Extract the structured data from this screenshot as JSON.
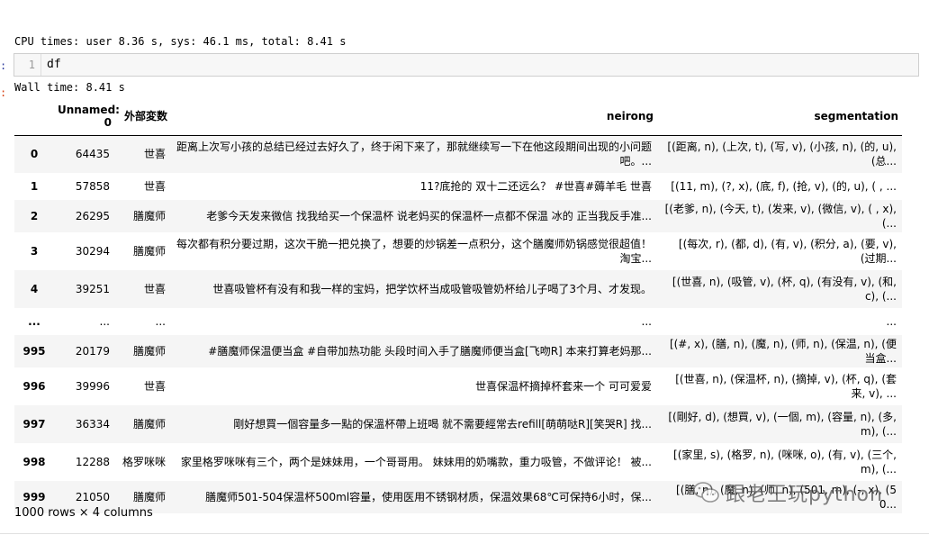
{
  "timing": {
    "cpu": "CPU times: user 8.36 s, sys: 46.1 ms, total: 8.41 s",
    "wall": "Wall time: 8.41 s"
  },
  "cell": {
    "prompt": ":",
    "line_number": "1",
    "code": "df",
    "out_prompt": ":"
  },
  "table": {
    "columns": [
      "Unnamed: 0",
      "外部変数",
      "neirong",
      "segmentation"
    ],
    "rows": [
      {
        "index": "0",
        "unnamed": "64435",
        "brand": "世喜",
        "neirong": "距离上次写小孩的总结已经过去好久了，终于闲下来了，那就继续写一下在他这段期间出现的小问题吧。...",
        "seg": "[(距离, n), (上次, t), (写, v), (小孩, n), (的, u), (总..."
      },
      {
        "index": "1",
        "unnamed": "57858",
        "brand": "世喜",
        "neirong": "11?底抢的 双十二还远么？ #世喜#薅羊毛 世喜",
        "seg": "[(11, m), (?, x), (底, f), (抢, v), (的, u), ( , ..."
      },
      {
        "index": "2",
        "unnamed": "26295",
        "brand": "膳魔师",
        "neirong": "老爹今天发来微信 找我给买一个保温杯 说老妈买的保温杯一点都不保温 冰的 正当我反手准...",
        "seg": "[(老爹, n), (今天, t), (发来, v), (微信, v), ( , x), (..."
      },
      {
        "index": "3",
        "unnamed": "30294",
        "brand": "膳魔师",
        "neirong": "每次都有积分要过期，这次干脆一把兑换了，想要的炒锅差一点积分，这个膳魔师奶锅感觉很超值！淘宝...",
        "seg": "[(每次, r), (都, d), (有, v), (积分, a), (要, v), (过期..."
      },
      {
        "index": "4",
        "unnamed": "39251",
        "brand": "世喜",
        "neirong": "世喜吸管杯有没有和我一样的宝妈，把学饮杯当成吸管吸管奶杯给儿子喝了3个月、才发现。",
        "seg": "[(世喜, n), (吸管, v), (杯, q), (有没有, v), (和, c), (..."
      },
      {
        "index": "...",
        "unnamed": "...",
        "brand": "...",
        "neirong": "...",
        "seg": "..."
      },
      {
        "index": "995",
        "unnamed": "20179",
        "brand": "膳魔师",
        "neirong": "#膳魔师保温便当盒 #自带加热功能 头段时间入手了膳魔师便当盒[飞吻R] 本来打算老妈那...",
        "seg": "[(#, x), (膳, n), (魔, n), (师, n), (保温, n), (便当盒..."
      },
      {
        "index": "996",
        "unnamed": "39996",
        "brand": "世喜",
        "neirong": "世喜保温杯摘掉杯套来一个 可可爱爱",
        "seg": "[(世喜, n), (保温杯, n), (摘掉, v), (杯, q), (套来, v), ..."
      },
      {
        "index": "997",
        "unnamed": "36334",
        "brand": "膳魔师",
        "neirong": "剛好想買一個容量多一點的保溫杯帶上班喝 就不需要經常去refill[萌萌哒R][笑哭R] 找...",
        "seg": "[(剛好, d), (想買, v), (一個, m), (容量, n), (多, m), (..."
      },
      {
        "index": "998",
        "unnamed": "12288",
        "brand": "格罗咪咪",
        "neirong": "家里格罗咪咪有三个，两个是妹妹用，一个哥哥用。 妹妹用的奶嘴款，重力吸管，不做评论！ 被...",
        "seg": "[(家里, s), (格罗, n), (咪咪, o), (有, v), (三个, m), (..."
      },
      {
        "index": "999",
        "unnamed": "21050",
        "brand": "膳魔师",
        "neirong": "膳魔师501-504保温杯500ml容量，使用医用不锈钢材质，保温效果68℃可保持6小时，保...",
        "seg": "[(膳, n), (魔, n), (师, n), (501, m), (-, x), (50..."
      }
    ]
  },
  "footer": "1000 rows × 4 columns",
  "watermark": "跟老王玩python"
}
